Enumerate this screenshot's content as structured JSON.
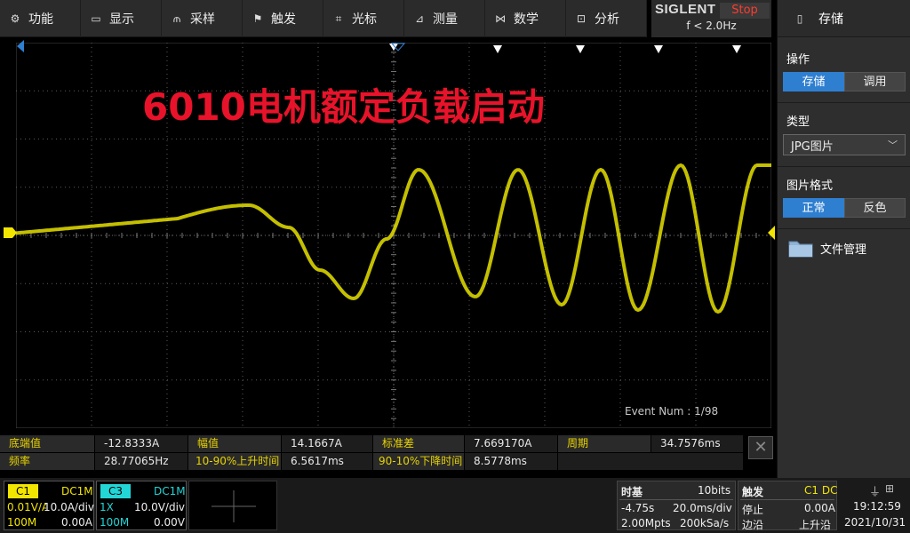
{
  "menu": [
    {
      "icon": "gear-icon",
      "glyph": "⚙",
      "label": "功能"
    },
    {
      "icon": "monitor-icon",
      "glyph": "▭",
      "label": "显示"
    },
    {
      "icon": "sample-icon",
      "glyph": "⫙",
      "label": "采样"
    },
    {
      "icon": "flag-icon",
      "glyph": "⚑",
      "label": "触发"
    },
    {
      "icon": "cursor-icon",
      "glyph": "⌗",
      "label": "光标"
    },
    {
      "icon": "measure-icon",
      "glyph": "⊿",
      "label": "测量"
    },
    {
      "icon": "math-icon",
      "glyph": "⋈",
      "label": "数学"
    },
    {
      "icon": "analysis-icon",
      "glyph": "⊡",
      "label": "分析"
    }
  ],
  "brand": {
    "name": "SIGLENT",
    "status": "Stop",
    "trigger_freq": "f < 2.0Hz"
  },
  "right_panel": {
    "header": "存储",
    "operation_title": "操作",
    "operation_options": [
      "存储",
      "调用"
    ],
    "type_title": "类型",
    "type_value": "JPG图片",
    "format_title": "图片格式",
    "format_options": [
      "正常",
      "反色"
    ],
    "file_manager": "文件管理"
  },
  "overlay_title": "6010电机额定负载启动",
  "event_num": "Event Num : 1/98",
  "measurements": {
    "row1": [
      {
        "label": "底端值",
        "value": "-12.8333A"
      },
      {
        "label": "幅值",
        "value": "14.1667A"
      },
      {
        "label": "标准差",
        "value": "7.669170A"
      },
      {
        "label": "周期",
        "value": "34.7576ms"
      }
    ],
    "row2": [
      {
        "label": "频率",
        "value": "28.77065Hz"
      },
      {
        "label": "10-90%上升时间",
        "value": "6.5617ms"
      },
      {
        "label": "90-10%下降时间",
        "value": "8.5778ms"
      }
    ]
  },
  "channels": {
    "c1": {
      "tag": "C1",
      "coupling": "DC1M",
      "scale_line": "0.01V/A",
      "scale": "10.0A/div",
      "bw": "100M",
      "offset": "0.00A",
      "color": "#f2e500"
    },
    "c3": {
      "tag": "C3",
      "coupling": "DC1M",
      "probe": "1X",
      "scale": "10.0V/div",
      "bw": "100M",
      "offset": "0.00V",
      "color": "#23d6d6"
    }
  },
  "timebase": {
    "title": "时基",
    "bits": "10bits",
    "delay": "-4.75s",
    "scale": "20.0ms/div",
    "points": "2.00Mpts",
    "rate": "200kSa/s"
  },
  "trigger": {
    "title": "触发",
    "source": "C1 DC",
    "mode": "停止",
    "level": "0.00A",
    "type": "边沿",
    "slope": "上升沿"
  },
  "clock": {
    "time": "19:12:59",
    "date": "2021/10/31"
  },
  "colors": {
    "trace": "#e6e000",
    "grid": "#5a5a5a",
    "accent": "#2f7fd0",
    "overlay": "#e8132a",
    "label": "#e8d300"
  }
}
